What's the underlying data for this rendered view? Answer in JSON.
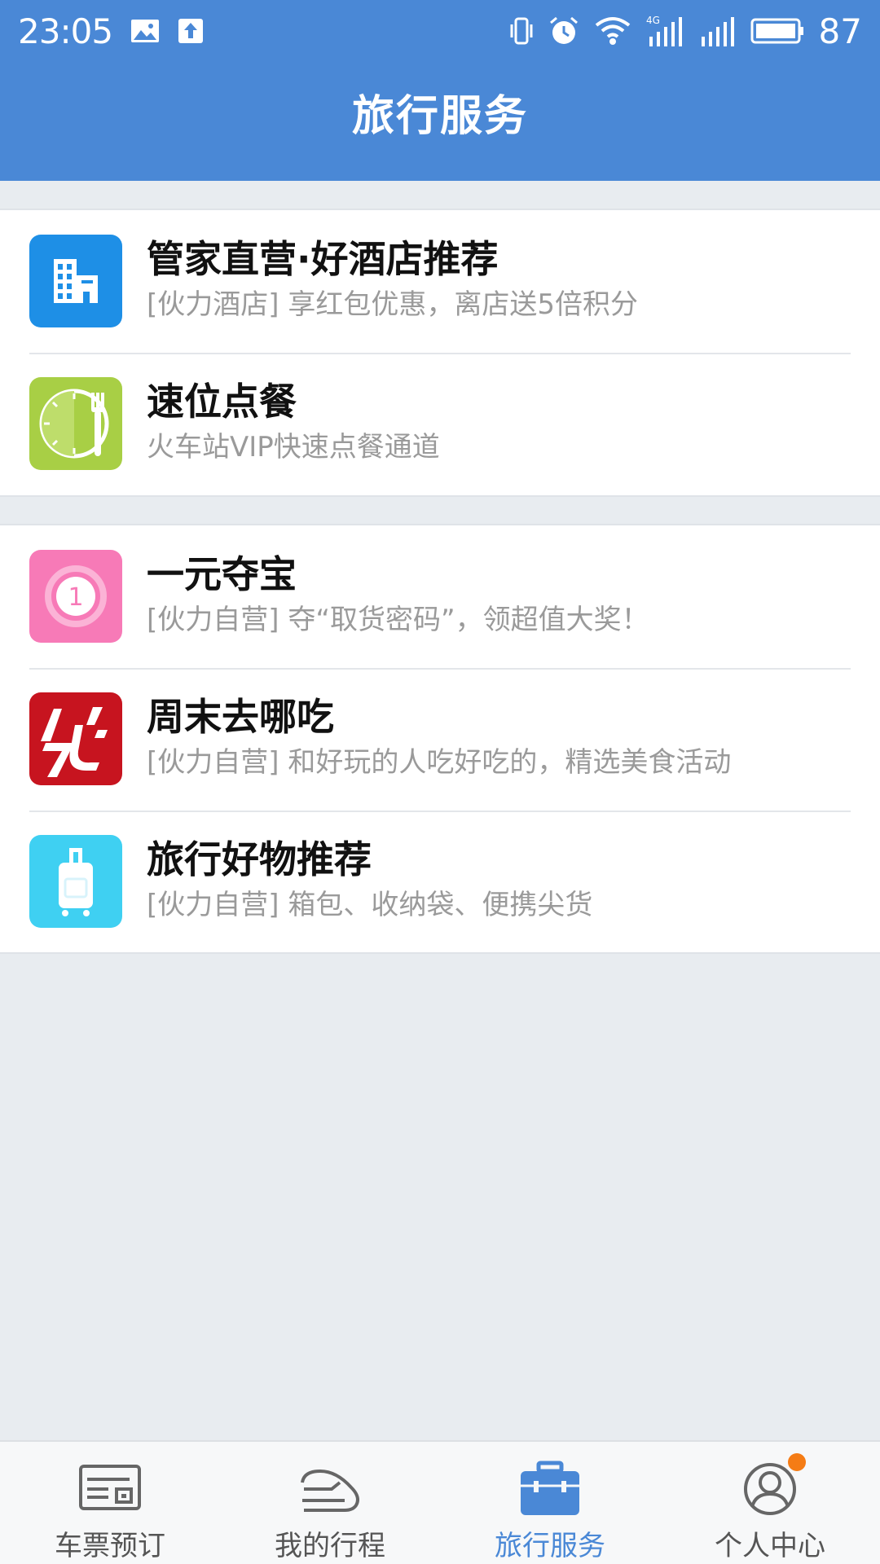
{
  "status_bar": {
    "time": "23:05",
    "battery": "87",
    "icons": [
      "image-icon",
      "upload-icon",
      "vibrate-icon",
      "alarm-icon",
      "wifi-icon",
      "signal-4g-icon",
      "signal-icon",
      "battery-icon"
    ]
  },
  "header": {
    "title": "旅行服务"
  },
  "groups": [
    {
      "items": [
        {
          "title": "管家直营·好酒店推荐",
          "subtitle": "[伙力酒店] 享红包优惠，离店送5倍积分",
          "icon": "hotel-building-icon",
          "color": "#1e8fe6"
        },
        {
          "title": "速位点餐",
          "subtitle": "火车站VIP快速点餐通道",
          "icon": "clock-fork-icon",
          "color": "#a8cf45"
        }
      ]
    },
    {
      "items": [
        {
          "title": "一元夺宝",
          "subtitle": "[伙力自营] 夺“取货密码”，领超值大奖！",
          "icon": "one-coin-icon",
          "color": "#f77ab7"
        },
        {
          "title": "周末去哪吃",
          "subtitle": "[伙力自营] 和好玩的人吃好吃的，精选美食活动",
          "icon": "eat-logo-icon",
          "color": "#c7141f"
        },
        {
          "title": "旅行好物推荐",
          "subtitle": "[伙力自营] 箱包、收纳袋、便携尖货",
          "icon": "suitcase-icon",
          "color": "#3fd0f2"
        }
      ]
    }
  ],
  "bottom_nav": {
    "items": [
      {
        "label": "车票预订",
        "icon": "ticket-icon",
        "active": false
      },
      {
        "label": "我的行程",
        "icon": "train-icon",
        "active": false
      },
      {
        "label": "旅行服务",
        "icon": "briefcase-icon",
        "active": true
      },
      {
        "label": "个人中心",
        "icon": "user-icon",
        "active": false,
        "badge": true
      }
    ]
  },
  "colors": {
    "primary": "#4a88d6",
    "background": "#e8ecf0",
    "badge": "#f57c15"
  }
}
